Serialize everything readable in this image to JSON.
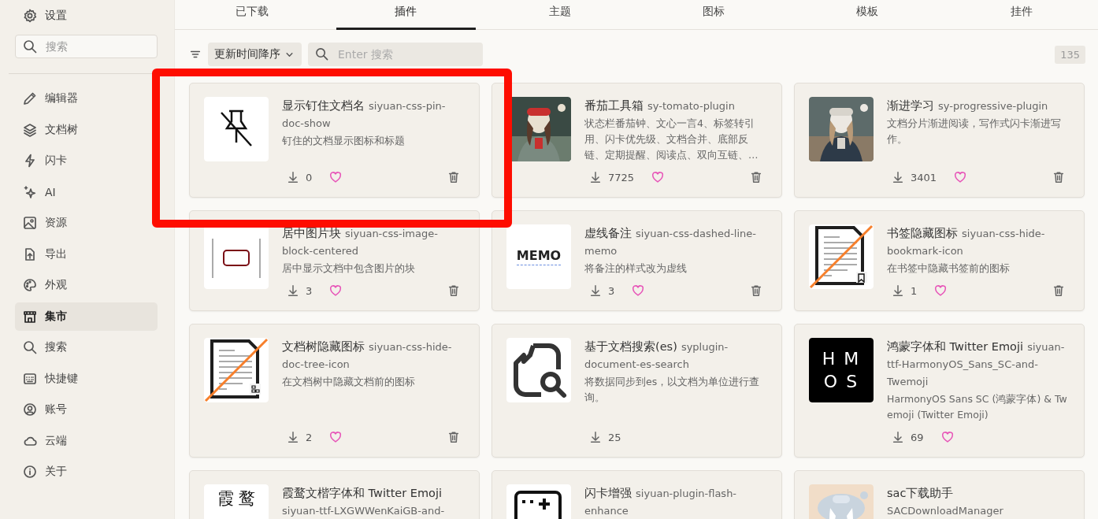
{
  "sidebar": {
    "header": {
      "label": "设置"
    },
    "search": {
      "placeholder": "搜索"
    },
    "items": [
      {
        "label": "编辑器",
        "selected": false
      },
      {
        "label": "文档树",
        "selected": false
      },
      {
        "label": "闪卡",
        "selected": false
      },
      {
        "label": "AI",
        "selected": false
      },
      {
        "label": "资源",
        "selected": false
      },
      {
        "label": "导出",
        "selected": false
      },
      {
        "label": "外观",
        "selected": false
      },
      {
        "label": "集市",
        "selected": true
      },
      {
        "label": "搜索",
        "selected": false
      },
      {
        "label": "快捷键",
        "selected": false
      },
      {
        "label": "账号",
        "selected": false
      },
      {
        "label": "云端",
        "selected": false
      },
      {
        "label": "关于",
        "selected": false
      }
    ]
  },
  "tabs": [
    {
      "label": "已下载",
      "selected": false
    },
    {
      "label": "插件",
      "selected": true
    },
    {
      "label": "主题",
      "selected": false
    },
    {
      "label": "图标",
      "selected": false
    },
    {
      "label": "模板",
      "selected": false
    },
    {
      "label": "挂件",
      "selected": false
    }
  ],
  "toolbar": {
    "sort": {
      "value": "更新时间降序"
    },
    "search": {
      "placeholder": "Enter 搜索"
    },
    "count": "135"
  },
  "cards": [
    {
      "icon": {
        "kind": "pin-off"
      },
      "name": "显示钉住文档名",
      "package": "siyuan-css-pin-doc-show",
      "description": "钉住的文档显示图标和标题",
      "downloads": "0",
      "heart": true,
      "deletable": true
    },
    {
      "name": "番茄工具箱",
      "package": "sy-tomato-plugin",
      "description": "状态栏番茄钟、文心一言4、标签转引用、闪卡优先级、文档合并、底部反链、定期提醒、阅读点、双向互链、…",
      "downloads": "7725",
      "heart": true,
      "deletable": true
    },
    {
      "name": "渐进学习",
      "package": "sy-progressive-plugin",
      "description": "文档分片渐进阅读，写作式闪卡渐进写作。",
      "downloads": "3401",
      "heart": true,
      "deletable": true
    },
    {
      "icon": {
        "kind": "frame"
      },
      "name": "居中图片块",
      "package": "siyuan-css-image-block-centered",
      "description": "居中显示文档中包含图片的块",
      "downloads": "3",
      "heart": true,
      "deletable": true
    },
    {
      "icon": {
        "kind": "memo",
        "text": "MEMO"
      },
      "name": "虚线备注",
      "package": "siyuan-css-dashed-line-memo",
      "description": "将备注的样式改为虚线",
      "downloads": "3",
      "heart": true,
      "deletable": true
    },
    {
      "icon": {
        "kind": "hide-bookmark"
      },
      "name": "书签隐藏图标",
      "package": "siyuan-css-hide-bookmark-icon",
      "description": "在书签中隐藏书签前的图标",
      "downloads": "1",
      "heart": true,
      "deletable": true
    },
    {
      "icon": {
        "kind": "hide-tree"
      },
      "name": "文档树隐藏图标",
      "package": "siyuan-css-hide-doc-tree-icon",
      "description": "在文档树中隐藏文档前的图标",
      "downloads": "2",
      "heart": true,
      "deletable": true
    },
    {
      "icon": {
        "kind": "doc-search"
      },
      "name": "基于文档搜索(es)",
      "package": "syplugin-document-es-search",
      "description": "将数据同步到es，以文档为单位进行查询。",
      "downloads": "25",
      "heart": false,
      "deletable": false
    },
    {
      "icon": {
        "kind": "letters",
        "lines": [
          "H M",
          "O S"
        ]
      },
      "name": "鸿蒙字体和 Twitter Emoji",
      "package": "siyuan-ttf-HarmonyOS_Sans_SC-and-Twemoji",
      "description": "HarmonyOS Sans SC (鸿蒙字体) & Twemoji (Twitter Emoji)",
      "downloads": "69",
      "heart": true,
      "deletable": false
    },
    {
      "icon": {
        "kind": "glyphs",
        "lines": [
          "霞 鹜"
        ]
      },
      "name": "霞鹜文楷字体和 Twitter Emoji",
      "package": "siyuan-ttf-LXGWWenKaiGB-and-"
    },
    {
      "icon": {
        "kind": "flashcard"
      },
      "name": "闪卡增强",
      "package": "siyuan-plugin-flash-enhance"
    },
    {
      "name": "sac下载助手",
      "package": "SACDownloadManager"
    }
  ],
  "annotation": {
    "kind": "frame"
  }
}
